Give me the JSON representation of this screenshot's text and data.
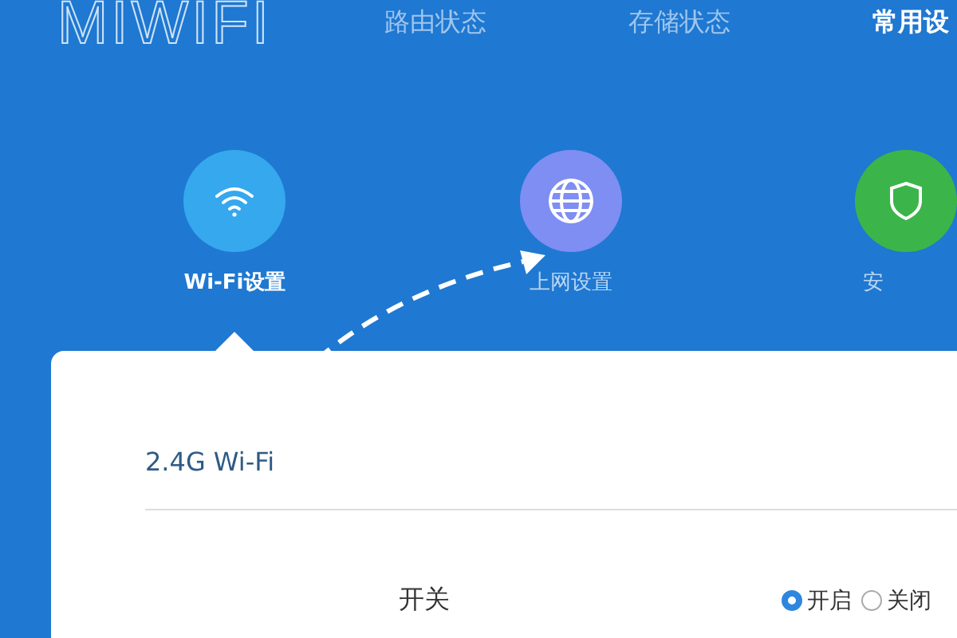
{
  "logo": "MIWIFI",
  "nav_tabs": [
    {
      "label": "路由状态",
      "selected": false
    },
    {
      "label": "存储状态",
      "selected": false
    },
    {
      "label": "常用设",
      "selected": true
    }
  ],
  "features": [
    {
      "label": "Wi-Fi设置",
      "kind": "wifi",
      "color": "#35a8ee",
      "selected": true
    },
    {
      "label": "上网设置",
      "kind": "globe",
      "color": "#7e8ef2",
      "selected": false
    },
    {
      "label": "安",
      "kind": "shield",
      "color": "#3bb54a",
      "selected": false
    }
  ],
  "panel": {
    "title": "2.4G Wi-Fi",
    "rows": [
      {
        "label": "开关",
        "options": [
          {
            "label": "开启",
            "selected": true
          },
          {
            "label": "关闭",
            "selected": false
          }
        ]
      }
    ]
  }
}
